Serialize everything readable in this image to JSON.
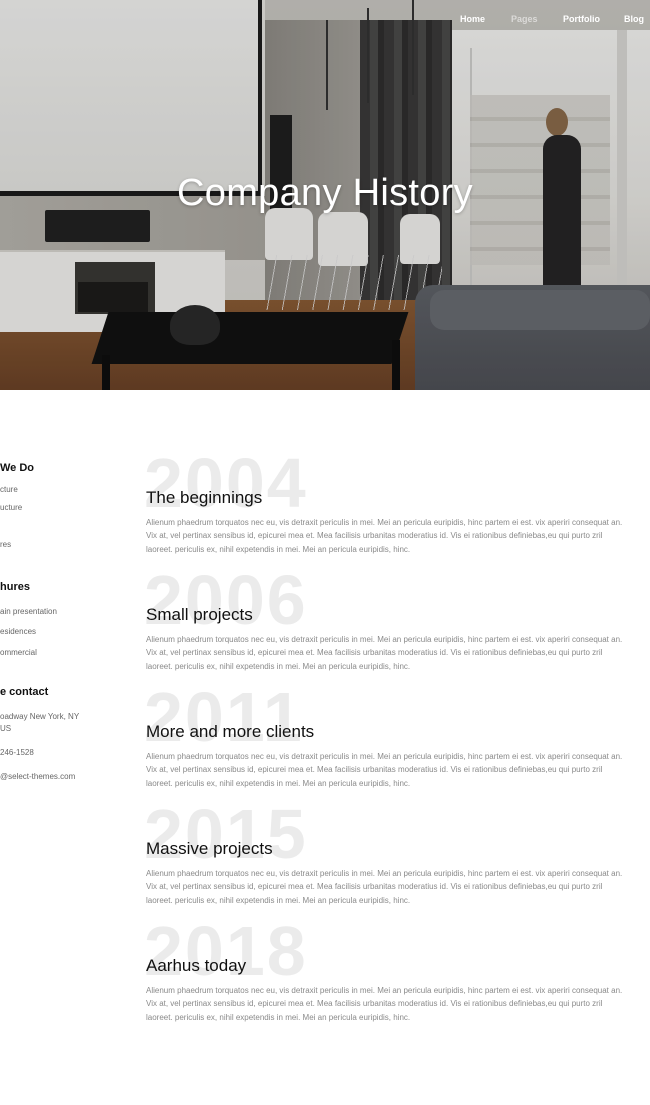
{
  "nav": {
    "items": [
      {
        "label": "Home"
      },
      {
        "label": "Pages"
      },
      {
        "label": "Portfolio"
      },
      {
        "label": "Blog"
      }
    ]
  },
  "hero": {
    "title": "Company History"
  },
  "sidebar": {
    "what_we_do": {
      "heading": "We Do",
      "items": [
        "cture",
        "ucture",
        "res"
      ]
    },
    "brochures": {
      "heading": "hures",
      "items": [
        "ain presentation",
        "esidences",
        "ommercial"
      ]
    },
    "contact": {
      "heading": "e contact",
      "address_line1": "oadway New York, NY",
      "address_line2": "US",
      "phone": "246-1528",
      "email": "@select-themes.com"
    }
  },
  "timeline": [
    {
      "year": "2004",
      "title": "The beginnings",
      "body": "Alienum phaedrum torquatos nec eu, vis detraxit periculis in mei. Mei an pericula euripidis, hinc partem ei est. vix aperiri consequat an. Vix at, vel pertinax sensibus id, epicurei mea et. Mea facilisis urbanitas moderatius id. Vis ei rationibus definiebas,eu qui purto zril laoreet. periculis ex, nihil expetendis in mei. Mei an pericula euripidis, hinc."
    },
    {
      "year": "2006",
      "title": "Small projects",
      "body": "Alienum phaedrum torquatos nec eu, vis detraxit periculis in mei. Mei an pericula euripidis, hinc partem ei est. vix aperiri consequat an. Vix at, vel pertinax sensibus id, epicurei mea et. Mea facilisis urbanitas moderatius id. Vis ei rationibus definiebas,eu qui purto zril laoreet. periculis ex, nihil expetendis in mei. Mei an pericula euripidis, hinc."
    },
    {
      "year": "2011",
      "title": "More and more clients",
      "body": "Alienum phaedrum torquatos nec eu, vis detraxit periculis in mei. Mei an pericula euripidis, hinc partem ei est. vix aperiri consequat an. Vix at, vel pertinax sensibus id, epicurei mea et. Mea facilisis urbanitas moderatius id. Vis ei rationibus definiebas,eu qui purto zril laoreet. periculis ex, nihil expetendis in mei. Mei an pericula euripidis, hinc."
    },
    {
      "year": "2015",
      "title": "Massive projects",
      "body": "Alienum phaedrum torquatos nec eu, vis detraxit periculis in mei. Mei an pericula euripidis, hinc partem ei est. vix aperiri consequat an. Vix at, vel pertinax sensibus id, epicurei mea et. Mea facilisis urbanitas moderatius id. Vis ei rationibus definiebas,eu qui purto zril laoreet. periculis ex, nihil expetendis in mei. Mei an pericula euripidis, hinc."
    },
    {
      "year": "2018",
      "title": "Aarhus today",
      "body": "Alienum phaedrum torquatos nec eu, vis detraxit periculis in mei. Mei an pericula euripidis, hinc partem ei est. vix aperiri consequat an. Vix at, vel pertinax sensibus id, epicurei mea et. Mea facilisis urbanitas moderatius id. Vis ei rationibus definiebas,eu qui purto zril laoreet. periculis ex, nihil expetendis in mei. Mei an pericula euripidis, hinc."
    }
  ]
}
